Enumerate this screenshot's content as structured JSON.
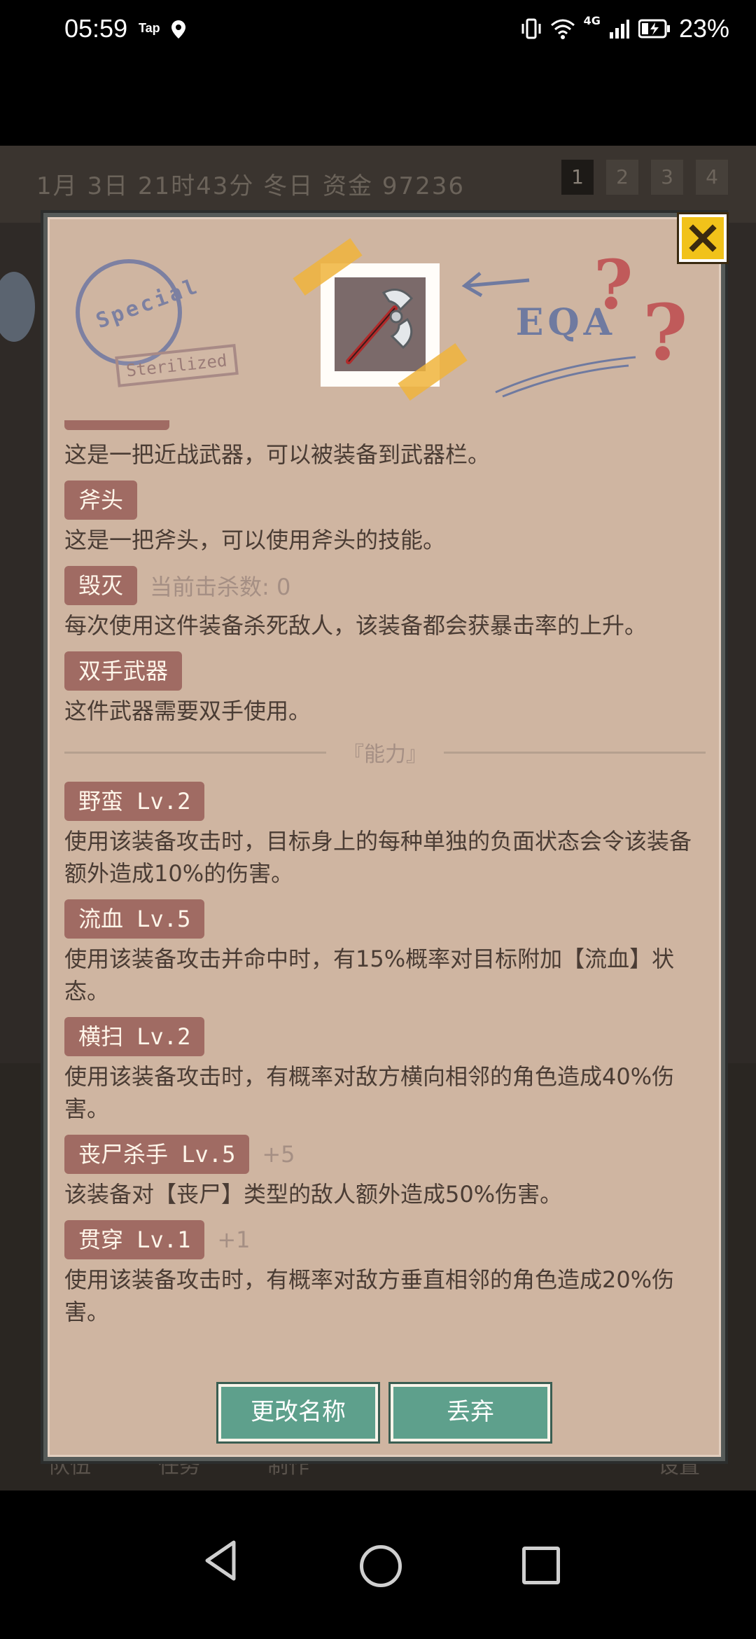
{
  "status_bar": {
    "time": "05:59",
    "tap_label": "Tap",
    "battery_pct": "23%",
    "network": "4G"
  },
  "background": {
    "top_info": "1月 3日 21时43分 冬日 资金 97236",
    "pages": [
      "1",
      "2",
      "3",
      "4"
    ],
    "bottom_nav": [
      "队伍",
      "任务",
      "制作",
      "设置"
    ]
  },
  "header": {
    "stamp_text": "Special",
    "sterilized_text": "Sterilized",
    "eqa_text": "EQA",
    "item_icon": "battle-axe-icon"
  },
  "traits": [
    {
      "name": "斧头",
      "desc": "这是一把斧头，可以使用斧头的技能。"
    },
    {
      "name": "毁灭",
      "extra": "当前击杀数: 0",
      "desc": "每次使用这件装备杀死敌人，该装备都会获暴击率的上升。"
    },
    {
      "name": "双手武器",
      "desc": "这件武器需要双手使用。"
    }
  ],
  "melee_desc": "这是一把近战武器，可以被装备到武器栏。",
  "abilities_title": "『能力』",
  "abilities": [
    {
      "name": "野蛮 Lv.2",
      "desc": "使用该装备攻击时，目标身上的每种单独的负面状态会令该装备额外造成10%的伤害。"
    },
    {
      "name": "流血 Lv.5",
      "desc": "使用该装备攻击并命中时，有15%概率对目标附加【流血】状态。"
    },
    {
      "name": "横扫 Lv.2",
      "desc": "使用该装备攻击时，有概率对敌方横向相邻的角色造成40%伤害。"
    },
    {
      "name": "丧尸杀手 Lv.5",
      "bonus": "+5",
      "desc": "该装备对【丧尸】类型的敌人额外造成50%伤害。"
    },
    {
      "name": "贯穿 Lv.1",
      "bonus": "+1",
      "desc": "使用该装备攻击时，有概率对敌方垂直相邻的角色造成20%伤害。"
    }
  ],
  "buttons": {
    "rename": "更改名称",
    "discard": "丢弃"
  },
  "colors": {
    "panel": "#cfb5a1",
    "tag": "#a06b63",
    "button": "#5ea08c",
    "close": "#f1c21a"
  }
}
